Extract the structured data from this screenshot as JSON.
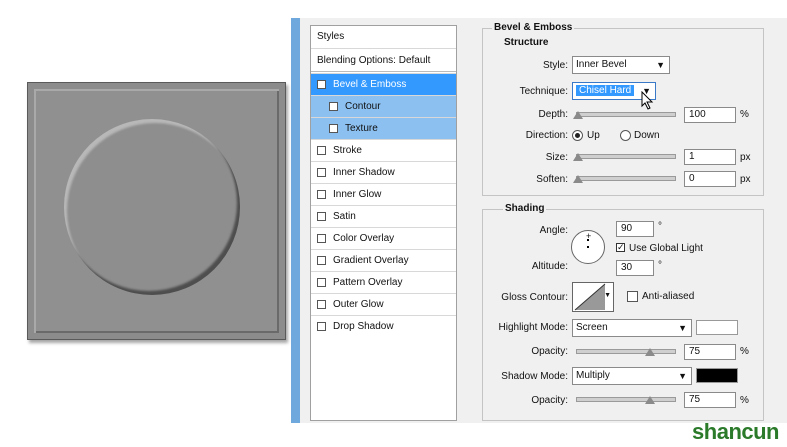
{
  "styles_panel": {
    "header": "Styles",
    "blending": "Blending Options: Default",
    "items": [
      {
        "label": "Bevel & Emboss",
        "checked": true,
        "state": "selected"
      },
      {
        "label": "Contour",
        "checked": false,
        "state": "sub"
      },
      {
        "label": "Texture",
        "checked": false,
        "state": "sub"
      },
      {
        "label": "Stroke",
        "checked": false,
        "state": ""
      },
      {
        "label": "Inner Shadow",
        "checked": false,
        "state": ""
      },
      {
        "label": "Inner Glow",
        "checked": false,
        "state": ""
      },
      {
        "label": "Satin",
        "checked": false,
        "state": ""
      },
      {
        "label": "Color Overlay",
        "checked": false,
        "state": ""
      },
      {
        "label": "Gradient Overlay",
        "checked": false,
        "state": ""
      },
      {
        "label": "Pattern Overlay",
        "checked": false,
        "state": ""
      },
      {
        "label": "Outer Glow",
        "checked": false,
        "state": ""
      },
      {
        "label": "Drop Shadow",
        "checked": false,
        "state": ""
      }
    ]
  },
  "bevel": {
    "title": "Bevel & Emboss",
    "structure": {
      "title": "Structure",
      "style_label": "Style:",
      "style_value": "Inner Bevel",
      "technique_label": "Technique:",
      "technique_value": "Chisel Hard",
      "depth_label": "Depth:",
      "depth_value": "100",
      "depth_unit": "%",
      "depth_level": 0.0,
      "direction_label": "Direction:",
      "direction_up": "Up",
      "direction_down": "Down",
      "size_label": "Size:",
      "size_value": "1",
      "size_unit": "px",
      "size_level": 0.0,
      "soften_label": "Soften:",
      "soften_value": "0",
      "soften_unit": "px",
      "soften_level": 0.0
    },
    "shading": {
      "title": "Shading",
      "angle_label": "Angle:",
      "angle_value": "90",
      "angle_unit": "°",
      "global_light_label": "Use Global Light",
      "global_light_checked": true,
      "altitude_label": "Altitude:",
      "altitude_value": "30",
      "altitude_unit": "°",
      "gloss_label": "Gloss Contour:",
      "antialiased_label": "Anti-aliased",
      "highlight_label": "Highlight Mode:",
      "highlight_value": "Screen",
      "highlight_color": "#ffffff",
      "highlight_opacity_label": "Opacity:",
      "highlight_opacity_value": "75",
      "highlight_opacity_unit": "%",
      "highlight_opacity_level": 0.75,
      "shadow_label": "Shadow Mode:",
      "shadow_value": "Multiply",
      "shadow_color": "#000000",
      "shadow_opacity_label": "Opacity:",
      "shadow_opacity_value": "75",
      "shadow_opacity_unit": "%",
      "shadow_opacity_level": 0.75
    }
  },
  "watermark": "shancun"
}
